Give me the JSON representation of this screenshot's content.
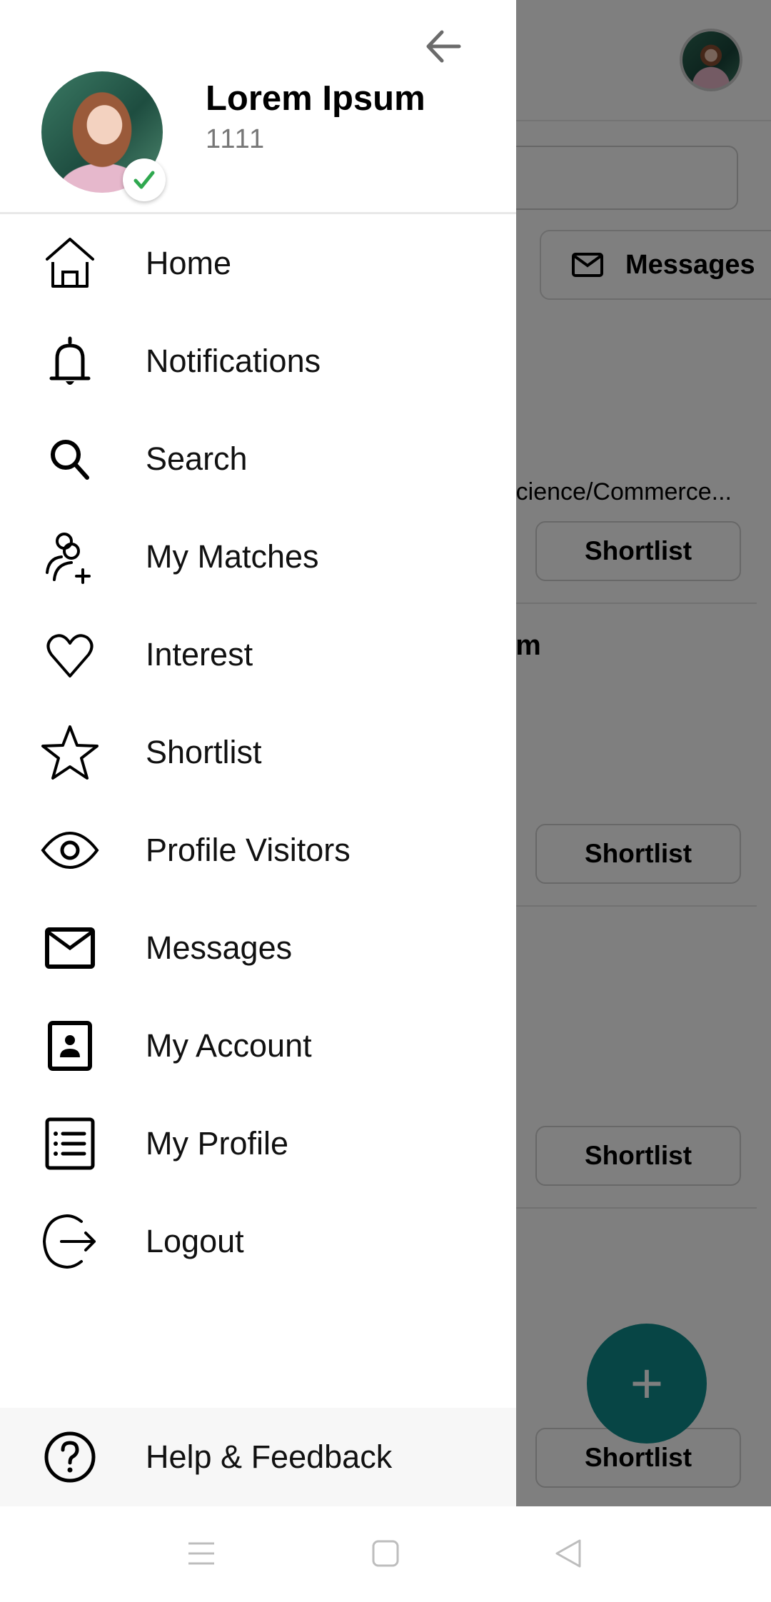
{
  "background_app": {
    "messages_button_label": "Messages",
    "education_snippet": "Science/Commerce...",
    "name_snippet": "am",
    "shortlist_buttons": [
      "Shortlist",
      "Shortlist",
      "Shortlist",
      "Shortlist"
    ],
    "fab_symbol": "+",
    "fab_color": "#0e8a8a"
  },
  "drawer": {
    "back_icon": "arrow-left-icon",
    "user": {
      "name": "Lorem Ipsum",
      "id": "1111",
      "verified": true,
      "verified_color": "#2fa84f"
    },
    "menu": [
      {
        "label": "Home",
        "icon": "home-icon"
      },
      {
        "label": "Notifications",
        "icon": "bell-icon"
      },
      {
        "label": "Search",
        "icon": "search-icon"
      },
      {
        "label": "My Matches",
        "icon": "user-plus-icon"
      },
      {
        "label": "Interest",
        "icon": "heart-icon"
      },
      {
        "label": "Shortlist",
        "icon": "star-icon"
      },
      {
        "label": "Profile Visitors",
        "icon": "eye-icon"
      },
      {
        "label": "Messages",
        "icon": "mail-icon"
      },
      {
        "label": "My Account",
        "icon": "account-box-icon"
      },
      {
        "label": "My Profile",
        "icon": "list-icon"
      },
      {
        "label": "Logout",
        "icon": "logout-icon"
      }
    ],
    "footer": {
      "label": "Help & Feedback",
      "icon": "help-circle-icon"
    }
  },
  "system_nav": {
    "recents": "recents-icon",
    "home": "home-square-icon",
    "back": "back-triangle-icon"
  }
}
